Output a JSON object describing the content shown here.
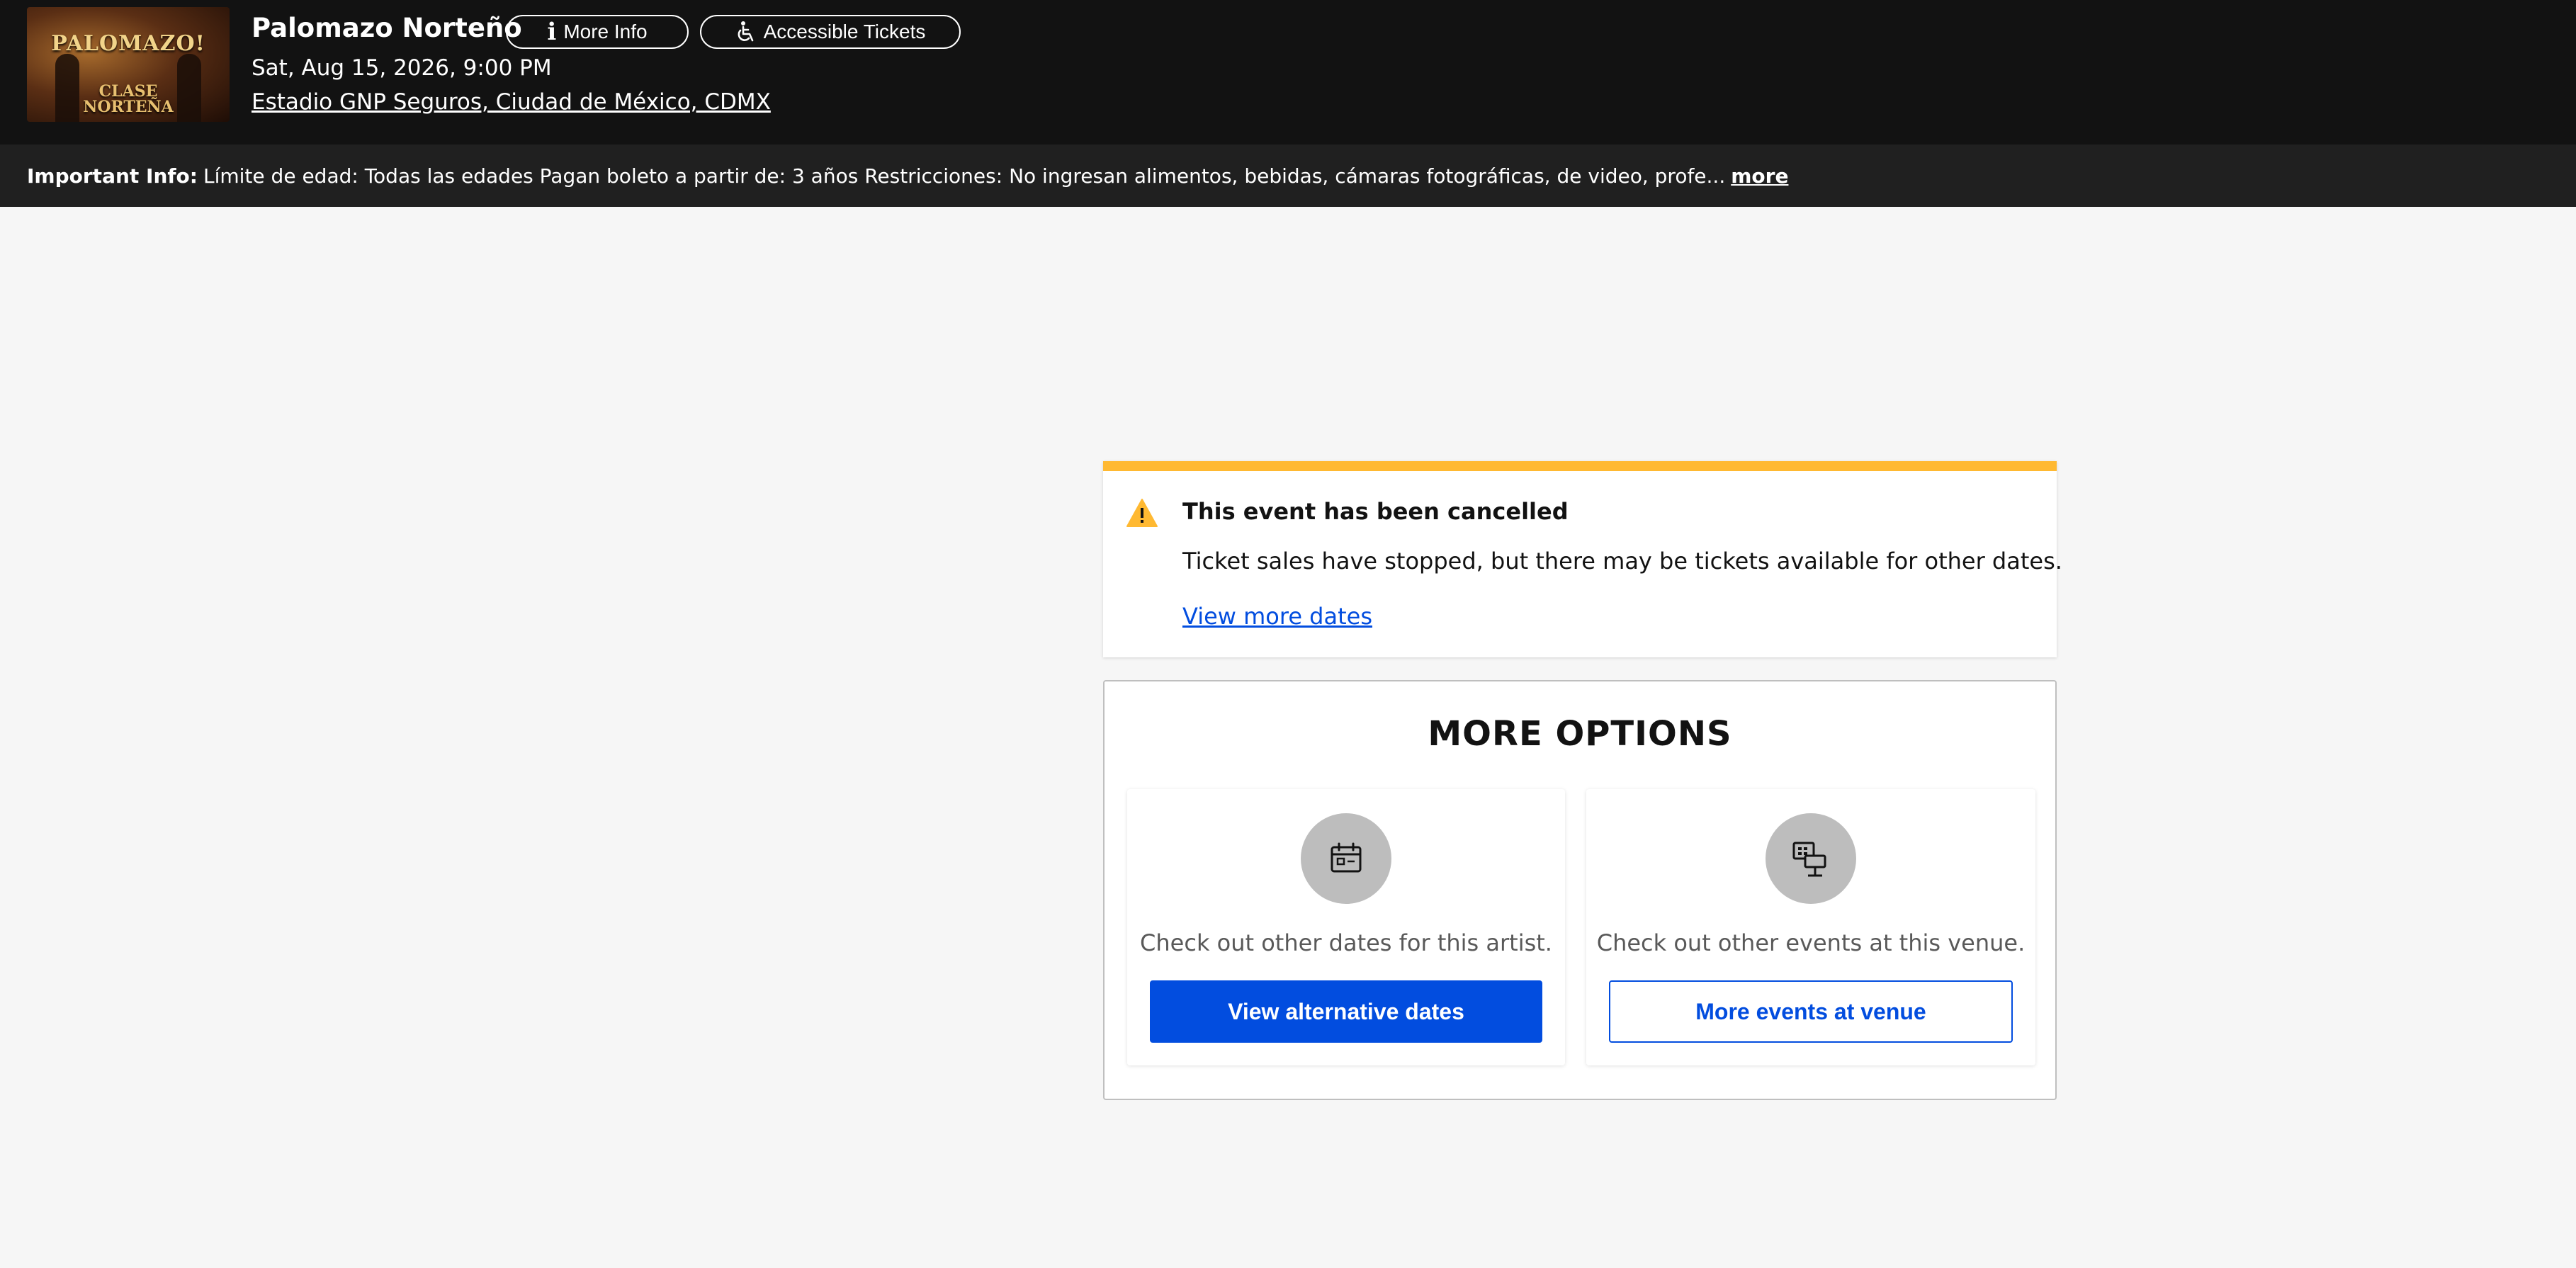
{
  "header": {
    "event_title": "Palomazo Norteño",
    "more_info_label": "More Info",
    "accessible_tickets_label": "Accessible Tickets",
    "event_date": "Sat, Aug 15, 2026, 9:00 PM",
    "venue": "Estadio GNP Seguros, Ciudad de México, CDMX",
    "thumbnail": {
      "top_text": "PALOMAZO!",
      "bottom_text_line1": "CLASE",
      "bottom_text_line2": "NORTEÑA"
    }
  },
  "info_bar": {
    "label": "Important Info:",
    "text": "Límite de edad: Todas las edades Pagan boleto a partir de: 3 años Restricciones: No ingresan alimentos, bebidas, cámaras fotográficas, de video, profe...",
    "more_label": "more"
  },
  "alert": {
    "title": "This event has been cancelled",
    "message": "Ticket sales have stopped, but there may be tickets available for other dates.",
    "link_label": "View more dates",
    "accent_color": "#ffb932"
  },
  "options": {
    "title": "MORE OPTIONS",
    "cards": [
      {
        "icon": "calendar-icon",
        "text": "Check out other dates for this artist.",
        "button_label": "View alternative dates"
      },
      {
        "icon": "venue-seats-icon",
        "text": "Check out other events at this venue.",
        "button_label": "More events at venue"
      }
    ]
  },
  "colors": {
    "header_bg": "#121212",
    "info_bar_bg": "#202020",
    "page_bg": "#f6f6f6",
    "primary": "#024ddf"
  }
}
